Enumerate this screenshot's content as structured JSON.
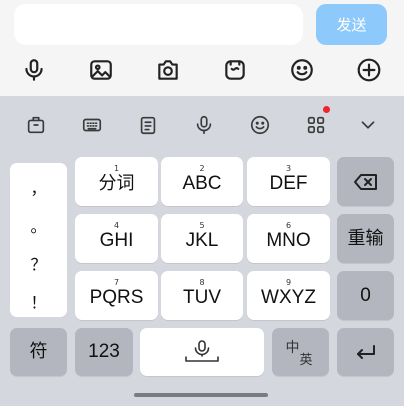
{
  "chat": {
    "input_value": "",
    "send_label": "发送",
    "tools": [
      "microphone-icon",
      "image-icon",
      "camera-icon",
      "emoji-sticker-icon",
      "smiley-icon",
      "plus-circle-icon"
    ]
  },
  "keyboard": {
    "toolbar": [
      "toolbox-icon",
      "keyboard-icon",
      "clipboard-icon",
      "microphone-icon",
      "emoji-icon",
      "apps-grid-icon",
      "chevron-down-icon"
    ],
    "colors": {
      "accent": "#8ec9fb",
      "badge": "#f0242c",
      "key_white": "#ffffff",
      "key_gray": "#b3b6bf",
      "background": "#d5d7de"
    },
    "punctuation": [
      "，",
      "。",
      "？",
      "！"
    ],
    "keys": [
      {
        "num": "1",
        "label": "分词"
      },
      {
        "num": "2",
        "label": "ABC"
      },
      {
        "num": "3",
        "label": "DEF"
      },
      {
        "num": "4",
        "label": "GHI"
      },
      {
        "num": "5",
        "label": "JKL"
      },
      {
        "num": "6",
        "label": "MNO"
      },
      {
        "num": "7",
        "label": "PQRS"
      },
      {
        "num": "8",
        "label": "TUV"
      },
      {
        "num": "9",
        "label": "WXYZ"
      }
    ],
    "right": {
      "backspace": "backspace-icon",
      "retype": "重输",
      "zero": "0"
    },
    "bottom": {
      "symbols": "符",
      "numbers": "123",
      "space": "space-mic-icon",
      "cn_big": "中",
      "cn_small": "英",
      "enter": "enter-icon"
    }
  }
}
